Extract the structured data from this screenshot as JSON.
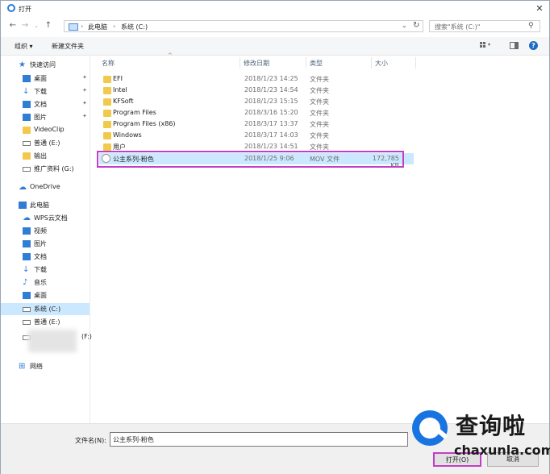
{
  "window": {
    "title": "打开",
    "close": "✕"
  },
  "address": {
    "breadcrumbs": [
      "此电脑",
      "系统 (C:)"
    ],
    "separator": "›",
    "search_placeholder": "搜索\"系统 (C:)\""
  },
  "toolbar": {
    "organize": "组织 ▾",
    "new_folder": "新建文件夹",
    "help": "?"
  },
  "nav": {
    "items": [
      {
        "label": "快速访问",
        "icon": "star-icon",
        "pinned": false
      },
      {
        "label": "桌面",
        "icon": "desktop-icon",
        "pinned": true
      },
      {
        "label": "下载",
        "icon": "download-icon",
        "pinned": true
      },
      {
        "label": "文档",
        "icon": "document-icon",
        "pinned": true
      },
      {
        "label": "图片",
        "icon": "picture-icon",
        "pinned": true
      },
      {
        "label": "VideoClip",
        "icon": "folder-icon",
        "pinned": false
      },
      {
        "label": "普通 (E:)",
        "icon": "drive-icon",
        "pinned": false
      },
      {
        "label": "输出",
        "icon": "folder-icon",
        "pinned": false
      },
      {
        "label": "推广资料 (G:)",
        "icon": "drive-icon",
        "pinned": false
      },
      {
        "label": "OneDrive",
        "icon": "cloud-icon",
        "pinned": false
      },
      {
        "label": "此电脑",
        "icon": "computer-icon",
        "pinned": false
      },
      {
        "label": "WPS云文档",
        "icon": "cloud-icon",
        "pinned": false
      },
      {
        "label": "视频",
        "icon": "video-icon",
        "pinned": false
      },
      {
        "label": "图片",
        "icon": "picture-icon",
        "pinned": false
      },
      {
        "label": "文档",
        "icon": "document-icon",
        "pinned": false
      },
      {
        "label": "下载",
        "icon": "download-icon",
        "pinned": false
      },
      {
        "label": "音乐",
        "icon": "music-icon",
        "pinned": false
      },
      {
        "label": "桌面",
        "icon": "desktop-icon",
        "pinned": false
      },
      {
        "label": "系统 (C:)",
        "icon": "drive-icon",
        "pinned": false,
        "selected": true
      },
      {
        "label": "普通 (E:)",
        "icon": "drive-icon",
        "pinned": false
      },
      {
        "label": "(F:)",
        "icon": "drive-icon",
        "pinned": false
      },
      {
        "label": "网络",
        "icon": "network-icon",
        "pinned": false
      }
    ],
    "pin_glyph": "✦"
  },
  "columns": {
    "name": "名称",
    "date": "修改日期",
    "type": "类型",
    "size": "大小"
  },
  "files": [
    {
      "name": "EFI",
      "date": "2018/1/23 14:25",
      "type": "文件夹",
      "size": ""
    },
    {
      "name": "Intel",
      "date": "2018/1/23 14:54",
      "type": "文件夹",
      "size": ""
    },
    {
      "name": "KFSoft",
      "date": "2018/1/23 15:15",
      "type": "文件夹",
      "size": ""
    },
    {
      "name": "Program Files",
      "date": "2018/3/16 15:20",
      "type": "文件夹",
      "size": ""
    },
    {
      "name": "Program Files (x86)",
      "date": "2018/3/17 13:37",
      "type": "文件夹",
      "size": ""
    },
    {
      "name": "Windows",
      "date": "2018/3/17 14:03",
      "type": "文件夹",
      "size": ""
    },
    {
      "name": "用户",
      "date": "2018/1/23 14:51",
      "type": "文件夹",
      "size": ""
    },
    {
      "name": "公主系列-粉色",
      "date": "2018/1/25 9:06",
      "type": "MOV 文件",
      "size": "172,785 KB",
      "selected": true
    }
  ],
  "footer": {
    "filename_label": "文件名(N):",
    "filename_value": "公主系列-粉色",
    "open": "打开(O)",
    "cancel": "取消"
  },
  "watermark": {
    "cn": "查询啦",
    "en": "chaxunla.com"
  },
  "colors": {
    "accent": "#1e6bc4",
    "selection": "#cce8ff",
    "highlight": "#c13fc6",
    "folder": "#f2c94c"
  }
}
